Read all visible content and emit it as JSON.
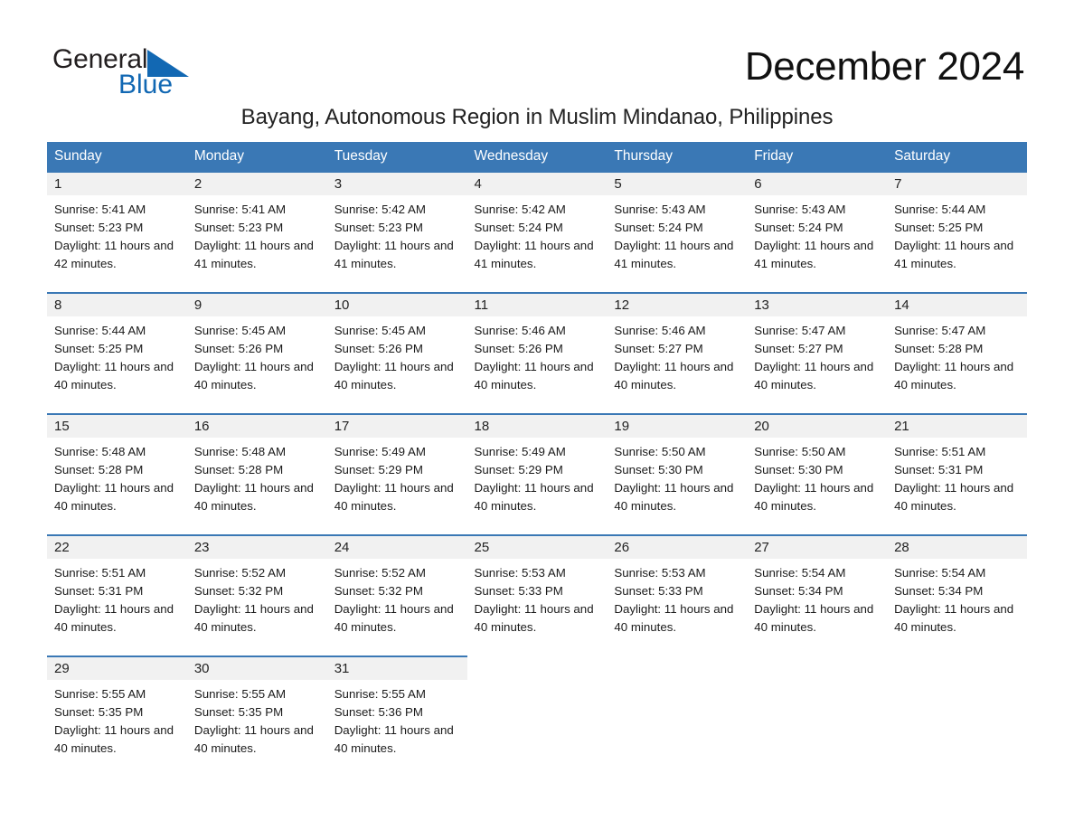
{
  "brand": {
    "name_part1": "General",
    "name_part2": "Blue",
    "accent_color": "#1268b3",
    "triangle_color": "#1268b3"
  },
  "header": {
    "month_title": "December 2024",
    "location": "Bayang, Autonomous Region in Muslim Mindanao, Philippines"
  },
  "calendar": {
    "header_bg": "#3a78b5",
    "daynum_bg": "#f1f1f1",
    "weekday_headers": [
      "Sunday",
      "Monday",
      "Tuesday",
      "Wednesday",
      "Thursday",
      "Friday",
      "Saturday"
    ],
    "weeks": [
      [
        {
          "day": "1",
          "sunrise": "Sunrise: 5:41 AM",
          "sunset": "Sunset: 5:23 PM",
          "daylight": "Daylight: 11 hours and 42 minutes."
        },
        {
          "day": "2",
          "sunrise": "Sunrise: 5:41 AM",
          "sunset": "Sunset: 5:23 PM",
          "daylight": "Daylight: 11 hours and 41 minutes."
        },
        {
          "day": "3",
          "sunrise": "Sunrise: 5:42 AM",
          "sunset": "Sunset: 5:23 PM",
          "daylight": "Daylight: 11 hours and 41 minutes."
        },
        {
          "day": "4",
          "sunrise": "Sunrise: 5:42 AM",
          "sunset": "Sunset: 5:24 PM",
          "daylight": "Daylight: 11 hours and 41 minutes."
        },
        {
          "day": "5",
          "sunrise": "Sunrise: 5:43 AM",
          "sunset": "Sunset: 5:24 PM",
          "daylight": "Daylight: 11 hours and 41 minutes."
        },
        {
          "day": "6",
          "sunrise": "Sunrise: 5:43 AM",
          "sunset": "Sunset: 5:24 PM",
          "daylight": "Daylight: 11 hours and 41 minutes."
        },
        {
          "day": "7",
          "sunrise": "Sunrise: 5:44 AM",
          "sunset": "Sunset: 5:25 PM",
          "daylight": "Daylight: 11 hours and 41 minutes."
        }
      ],
      [
        {
          "day": "8",
          "sunrise": "Sunrise: 5:44 AM",
          "sunset": "Sunset: 5:25 PM",
          "daylight": "Daylight: 11 hours and 40 minutes."
        },
        {
          "day": "9",
          "sunrise": "Sunrise: 5:45 AM",
          "sunset": "Sunset: 5:26 PM",
          "daylight": "Daylight: 11 hours and 40 minutes."
        },
        {
          "day": "10",
          "sunrise": "Sunrise: 5:45 AM",
          "sunset": "Sunset: 5:26 PM",
          "daylight": "Daylight: 11 hours and 40 minutes."
        },
        {
          "day": "11",
          "sunrise": "Sunrise: 5:46 AM",
          "sunset": "Sunset: 5:26 PM",
          "daylight": "Daylight: 11 hours and 40 minutes."
        },
        {
          "day": "12",
          "sunrise": "Sunrise: 5:46 AM",
          "sunset": "Sunset: 5:27 PM",
          "daylight": "Daylight: 11 hours and 40 minutes."
        },
        {
          "day": "13",
          "sunrise": "Sunrise: 5:47 AM",
          "sunset": "Sunset: 5:27 PM",
          "daylight": "Daylight: 11 hours and 40 minutes."
        },
        {
          "day": "14",
          "sunrise": "Sunrise: 5:47 AM",
          "sunset": "Sunset: 5:28 PM",
          "daylight": "Daylight: 11 hours and 40 minutes."
        }
      ],
      [
        {
          "day": "15",
          "sunrise": "Sunrise: 5:48 AM",
          "sunset": "Sunset: 5:28 PM",
          "daylight": "Daylight: 11 hours and 40 minutes."
        },
        {
          "day": "16",
          "sunrise": "Sunrise: 5:48 AM",
          "sunset": "Sunset: 5:28 PM",
          "daylight": "Daylight: 11 hours and 40 minutes."
        },
        {
          "day": "17",
          "sunrise": "Sunrise: 5:49 AM",
          "sunset": "Sunset: 5:29 PM",
          "daylight": "Daylight: 11 hours and 40 minutes."
        },
        {
          "day": "18",
          "sunrise": "Sunrise: 5:49 AM",
          "sunset": "Sunset: 5:29 PM",
          "daylight": "Daylight: 11 hours and 40 minutes."
        },
        {
          "day": "19",
          "sunrise": "Sunrise: 5:50 AM",
          "sunset": "Sunset: 5:30 PM",
          "daylight": "Daylight: 11 hours and 40 minutes."
        },
        {
          "day": "20",
          "sunrise": "Sunrise: 5:50 AM",
          "sunset": "Sunset: 5:30 PM",
          "daylight": "Daylight: 11 hours and 40 minutes."
        },
        {
          "day": "21",
          "sunrise": "Sunrise: 5:51 AM",
          "sunset": "Sunset: 5:31 PM",
          "daylight": "Daylight: 11 hours and 40 minutes."
        }
      ],
      [
        {
          "day": "22",
          "sunrise": "Sunrise: 5:51 AM",
          "sunset": "Sunset: 5:31 PM",
          "daylight": "Daylight: 11 hours and 40 minutes."
        },
        {
          "day": "23",
          "sunrise": "Sunrise: 5:52 AM",
          "sunset": "Sunset: 5:32 PM",
          "daylight": "Daylight: 11 hours and 40 minutes."
        },
        {
          "day": "24",
          "sunrise": "Sunrise: 5:52 AM",
          "sunset": "Sunset: 5:32 PM",
          "daylight": "Daylight: 11 hours and 40 minutes."
        },
        {
          "day": "25",
          "sunrise": "Sunrise: 5:53 AM",
          "sunset": "Sunset: 5:33 PM",
          "daylight": "Daylight: 11 hours and 40 minutes."
        },
        {
          "day": "26",
          "sunrise": "Sunrise: 5:53 AM",
          "sunset": "Sunset: 5:33 PM",
          "daylight": "Daylight: 11 hours and 40 minutes."
        },
        {
          "day": "27",
          "sunrise": "Sunrise: 5:54 AM",
          "sunset": "Sunset: 5:34 PM",
          "daylight": "Daylight: 11 hours and 40 minutes."
        },
        {
          "day": "28",
          "sunrise": "Sunrise: 5:54 AM",
          "sunset": "Sunset: 5:34 PM",
          "daylight": "Daylight: 11 hours and 40 minutes."
        }
      ],
      [
        {
          "day": "29",
          "sunrise": "Sunrise: 5:55 AM",
          "sunset": "Sunset: 5:35 PM",
          "daylight": "Daylight: 11 hours and 40 minutes."
        },
        {
          "day": "30",
          "sunrise": "Sunrise: 5:55 AM",
          "sunset": "Sunset: 5:35 PM",
          "daylight": "Daylight: 11 hours and 40 minutes."
        },
        {
          "day": "31",
          "sunrise": "Sunrise: 5:55 AM",
          "sunset": "Sunset: 5:36 PM",
          "daylight": "Daylight: 11 hours and 40 minutes."
        },
        {
          "day": "",
          "sunrise": "",
          "sunset": "",
          "daylight": ""
        },
        {
          "day": "",
          "sunrise": "",
          "sunset": "",
          "daylight": ""
        },
        {
          "day": "",
          "sunrise": "",
          "sunset": "",
          "daylight": ""
        },
        {
          "day": "",
          "sunrise": "",
          "sunset": "",
          "daylight": ""
        }
      ]
    ]
  }
}
